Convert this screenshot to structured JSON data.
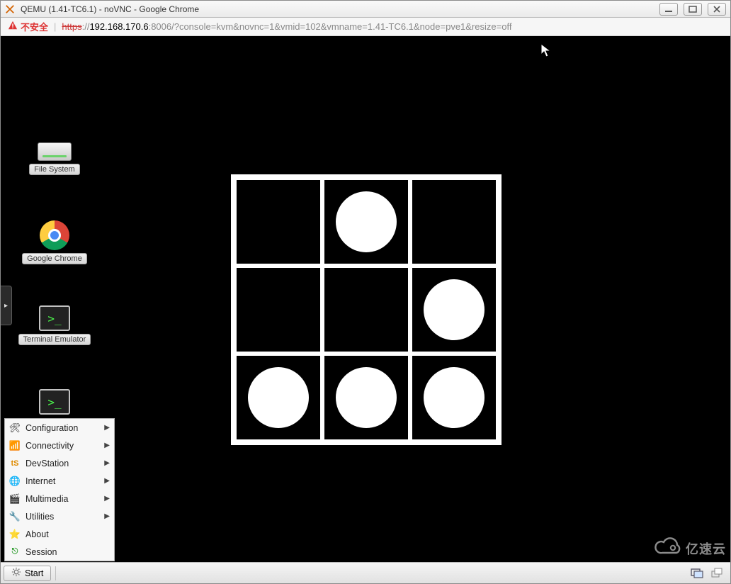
{
  "window": {
    "title": "QEMU (1.41-TC6.1) - noVNC - Google Chrome",
    "min_label": "Minimize",
    "max_label": "Maximize",
    "close_label": "Close"
  },
  "url_bar": {
    "warning_text": "不安全",
    "scheme": "https",
    "sep": "://",
    "host": "192.168.170.6",
    "port_path": ":8006/?console=kvm&novnc=1&vmid=102&vmname=1.41-TC6.1&node=pve1&resize=off"
  },
  "desktop_icons": {
    "fs": {
      "label": "File System"
    },
    "chrome": {
      "label": "Google Chrome"
    },
    "term1": {
      "label": "Terminal Emulator"
    },
    "term2": {
      "label": ""
    }
  },
  "spinner_dots": [
    false,
    true,
    false,
    false,
    false,
    true,
    true,
    true,
    true
  ],
  "vnc_tab": {
    "glyph": "▸"
  },
  "menu": {
    "items": [
      {
        "icon": "🛠",
        "label": "Configuration",
        "submenu": true
      },
      {
        "icon": "📶",
        "label": "Connectivity",
        "submenu": true
      },
      {
        "icon": "tS",
        "label": "DevStation",
        "submenu": true,
        "icon_color": "#e08b00"
      },
      {
        "icon": "🌐",
        "label": "Internet",
        "submenu": true
      },
      {
        "icon": "🎬",
        "label": "Multimedia",
        "submenu": true
      },
      {
        "icon": "🔧",
        "label": "Utilities",
        "submenu": true
      },
      {
        "icon": "⭐",
        "label": "About",
        "submenu": false
      },
      {
        "icon": "⎋",
        "label": "Session",
        "submenu": false,
        "icon_color": "#2a9b2a"
      }
    ]
  },
  "taskbar": {
    "start_label": "Start"
  },
  "watermark": {
    "text": "亿速云"
  }
}
